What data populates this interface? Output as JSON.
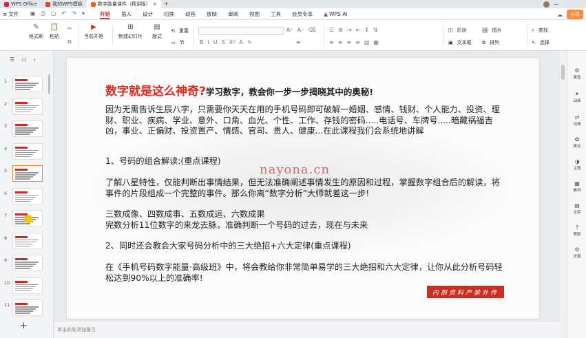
{
  "tabs": [
    {
      "label": "WPS Office",
      "active": false
    },
    {
      "label": "我的WPS模板",
      "active": false
    },
    {
      "label": "数字能量课件（精讲版）",
      "active": true
    }
  ],
  "menubar": {
    "file_label": "文件",
    "items": [
      "开始",
      "插入",
      "设计",
      "切换",
      "动画",
      "放映",
      "审阅",
      "视图",
      "工具",
      "会员专享"
    ],
    "ai_label": "WPS AI",
    "share_label": "分享"
  },
  "ribbon": {
    "format_painter": "格式刷",
    "paste": "粘贴",
    "play_from_current": "当前开始",
    "new_slide": "新建幻灯片",
    "layout": "版式",
    "section": "节",
    "reset": "重置",
    "shape": "形状",
    "picture": "图片",
    "textbox": "文本框",
    "arrange": "排列",
    "find": "查找",
    "select": "选择"
  },
  "slides_panel": {
    "numbers": [
      "1",
      "2",
      "3",
      "4",
      "5",
      "6",
      "7",
      "8",
      "9",
      "10",
      "11"
    ],
    "active_index": 4
  },
  "slide": {
    "title_big": "数字就是这么神奇?",
    "title_sub": "学习数字，教会你一步一步揭晓其中的奥秘!",
    "p1": "因为无需告诉生辰八字，只需要你天天在用的手机号码即可破解一婚姻、感情、钱财、个人能力、投资、理财、职业、疾病、学业、意外、口角、血光、个性、工作、存钱的密码.....电话号、车牌号.....暗藏祸福吉凶，事业、正偏财、投资置产、情感、官司、贵人、健康...在此课程我们会系统地讲解",
    "h1": "1、号码的组合解读:(重点课程)",
    "p2": "了解八星特性，仅能判断出事情结果，但无法准确阐述事情发生的原因和过程，掌握数字组合后的解读，将事件的片段组成一个完整的事件。那么你离“数字分析”大师就差这一步!",
    "p3a": "三数成像、四数成事、五数成运、六数成果",
    "p3b": "完数分析11位数字的来龙去脉，准确判断一个号码的过去，现在与未来",
    "h2": "2、同时还会教会大家号码分析中的三大绝招+六大定律(重点课程)",
    "p4": "在《手机号码数字能量·高级班》中，将会教给你非常简单易学的三大绝招和六大定律，让你从此分析号码轻松达到90%以上的准确率!",
    "watermark": "nayona.cn",
    "stamp": "内部资料严禁外传"
  },
  "notes_placeholder": "单击此处添加备注",
  "side_panel": [
    "属性",
    "动画",
    "切换",
    "美化",
    "主题",
    "素材",
    "文库",
    "帮助",
    "设置"
  ],
  "colors": {
    "accent": "#c0392b",
    "title_red": "#e02a1e",
    "share": "#ff8a3d"
  }
}
